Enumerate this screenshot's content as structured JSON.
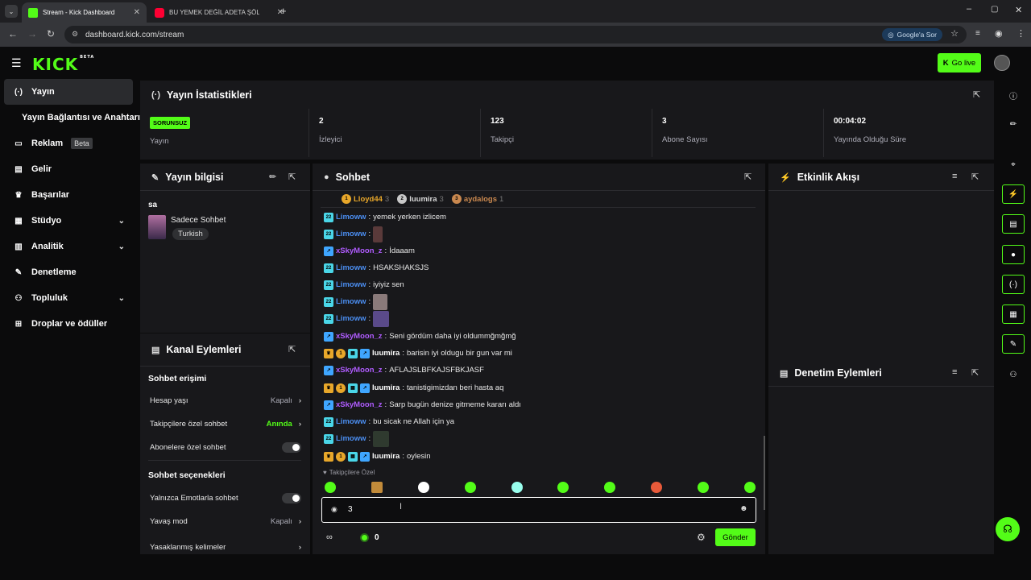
{
  "browser": {
    "tabs": [
      {
        "title": "Stream - Kick Dashboard",
        "active": true
      },
      {
        "title": "BU YEMEK DEĞİL ADETA ŞÖLEN",
        "active": false
      }
    ],
    "url": "dashboard.kick.com/stream",
    "google_btn": "Google'a Sor"
  },
  "app": {
    "logo": "KICK",
    "logo_tag": "BETA",
    "go_live": "Go live"
  },
  "sidebar": {
    "items": [
      {
        "label": "Yayın",
        "icon": "broadcast-icon"
      },
      {
        "label": "Yayın Bağlantısı ve Anahtarı",
        "icon": ""
      },
      {
        "label": "Reklam",
        "icon": "ad-icon",
        "badge": "Beta"
      },
      {
        "label": "Gelir",
        "icon": "revenue-icon"
      },
      {
        "label": "Başarılar",
        "icon": "trophy-icon"
      },
      {
        "label": "Stüdyo",
        "icon": "studio-icon"
      },
      {
        "label": "Analitik",
        "icon": "analytics-icon"
      },
      {
        "label": "Denetleme",
        "icon": "wrench-icon"
      },
      {
        "label": "Topluluk",
        "icon": "community-icon"
      },
      {
        "label": "Droplar ve ödüller",
        "icon": "drops-icon"
      }
    ]
  },
  "stats": {
    "title": "Yayın İstatistikleri",
    "status": "SORUNSUZ",
    "status_label": "Yayın",
    "items": [
      {
        "value": "2",
        "label": "İzleyici"
      },
      {
        "value": "123",
        "label": "Takipçi"
      },
      {
        "value": "3",
        "label": "Abone Sayısı"
      },
      {
        "value": "00:04:02",
        "label": "Yayında Olduğu Süre"
      }
    ]
  },
  "stream_info": {
    "title": "Yayın bilgisi",
    "stream_title": "sa",
    "category": "Sadece Sohbet",
    "tag": "Turkish"
  },
  "channel_actions": {
    "title": "Kanal Eylemleri",
    "section1": "Sohbet erişimi",
    "rows1": [
      {
        "label": "Hesap yaşı",
        "value": "Kapalı"
      },
      {
        "label": "Takipçilere özel sohbet",
        "value": "Anında"
      },
      {
        "label": "Abonelere özel sohbet",
        "value": ""
      }
    ],
    "section2": "Sohbet seçenekleri",
    "rows2": [
      {
        "label": "Yalnızca Emotlarla sohbet",
        "value": ""
      },
      {
        "label": "Yavaş mod",
        "value": "Kapalı"
      },
      {
        "label": "Yasaklanmış kelimeler",
        "value": ""
      }
    ]
  },
  "chat": {
    "title": "Sohbet",
    "leaders": [
      {
        "rank": "1",
        "name": "Lloyd44",
        "count": "3"
      },
      {
        "rank": "2",
        "name": "luumira",
        "count": "3"
      },
      {
        "rank": "3",
        "name": "aydalogs",
        "count": "1"
      }
    ],
    "messages": [
      {
        "user": "Limoww",
        "text": "yemek yerken izlicem"
      },
      {
        "user": "Limoww",
        "text": ""
      },
      {
        "user": "xSkyMoon_z",
        "text": "İdaaam"
      },
      {
        "user": "Limoww",
        "text": "HSAKSHAKSJS"
      },
      {
        "user": "Limoww",
        "text": "iyiyiz sen"
      },
      {
        "user": "Limoww",
        "text": ""
      },
      {
        "user": "Limoww",
        "text": ""
      },
      {
        "user": "xSkyMoon_z",
        "text": "Seni gördüm daha iyi oldummğmğmğ"
      },
      {
        "user": "luumira",
        "text": "barisin iyi oldugu bir gun var mi"
      },
      {
        "user": "xSkyMoon_z",
        "text": "AFLAJSLBFKAJSFBKJASF"
      },
      {
        "user": "luumira",
        "text": "tanistigimizdan beri hasta aq"
      },
      {
        "user": "xSkyMoon_z",
        "text": "Sarp bugün denize gitmeme kararı aldı"
      },
      {
        "user": "Limoww",
        "text": "bu sicak ne Allah için ya"
      },
      {
        "user": "Limoww",
        "text": ""
      },
      {
        "user": "luumira",
        "text": "oylesin"
      }
    ],
    "followers_only": "Takipçilere Özel",
    "input_value": "3",
    "points": "0",
    "send": "Gönder"
  },
  "activity": {
    "title": "Etkinlik Akışı"
  },
  "moderation": {
    "title": "Denetim Eylemleri"
  },
  "colors": {
    "accent": "#53fc18",
    "panel": "#18181b",
    "bg": "#0b0b0c"
  }
}
